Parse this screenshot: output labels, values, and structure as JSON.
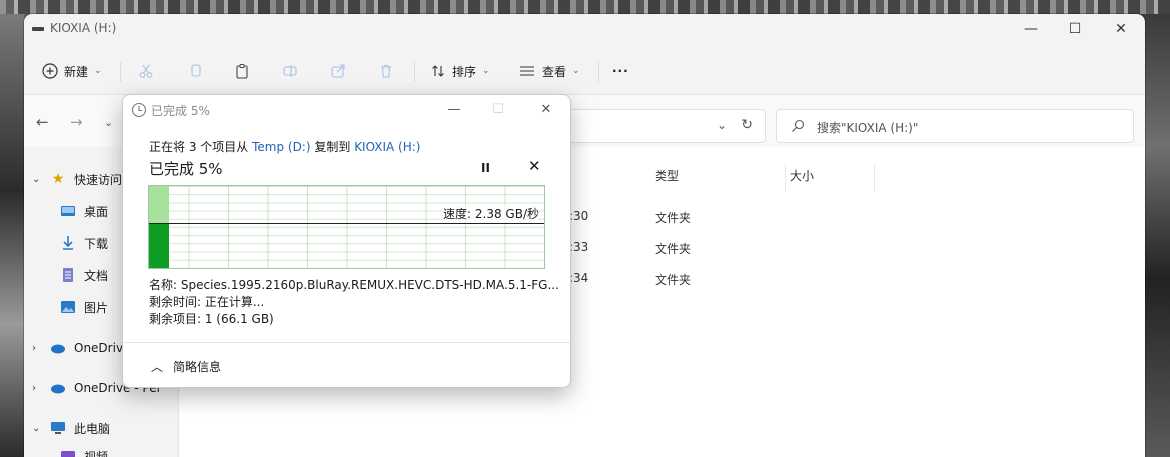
{
  "window": {
    "title": "KIOXIA (H:)",
    "controls": {
      "minimize": "—",
      "maximize": "☐",
      "close": "✕"
    }
  },
  "commandbar": {
    "new_label": "新建",
    "sort_label": "排序",
    "view_label": "查看",
    "more_label": "···"
  },
  "addressbar": {
    "search_placeholder": "搜索\"KIOXIA (H:)\""
  },
  "sidebar": {
    "quick_access": "快速访问",
    "items": [
      {
        "label": "桌面",
        "icon": "desktop-icon"
      },
      {
        "label": "下载",
        "icon": "download-icon"
      },
      {
        "label": "文档",
        "icon": "document-icon"
      },
      {
        "label": "图片",
        "icon": "pictures-icon"
      }
    ],
    "onedrive_1": "OneDrive",
    "onedrive_2": "OneDrive - Per",
    "this_pc": "此电脑",
    "videos": "视频"
  },
  "filelist": {
    "columns": {
      "type": "类型",
      "size": "大小"
    },
    "rows": [
      {
        "time": ":30",
        "type": "文件夹"
      },
      {
        "time": ":33",
        "type": "文件夹"
      },
      {
        "time": ":34",
        "type": "文件夹"
      }
    ]
  },
  "dialog": {
    "title": "已完成 5%",
    "copy_prefix": "正在将 3 个项目从 ",
    "source": "Temp (D:)",
    "copy_middle": " 复制到 ",
    "destination": "KIOXIA (H:)",
    "heading": "已完成 5%",
    "pause": "II",
    "cancel": "✕",
    "progress_fraction": 0.05,
    "speed": "速度: 2.38 GB/秒",
    "name_line": "名称: Species.1995.2160p.BluRay.REMUX.HEVC.DTS-HD.MA.5.1-FG...",
    "time_remaining": "剩余时间: 正在计算...",
    "items_remaining": "剩余项目: 1 (66.1 GB)",
    "less_details": "简略信息",
    "colors": {
      "graph_fill": "#0f9d25",
      "graph_fill_light": "#a6e29c",
      "link": "#1f63b5"
    }
  }
}
